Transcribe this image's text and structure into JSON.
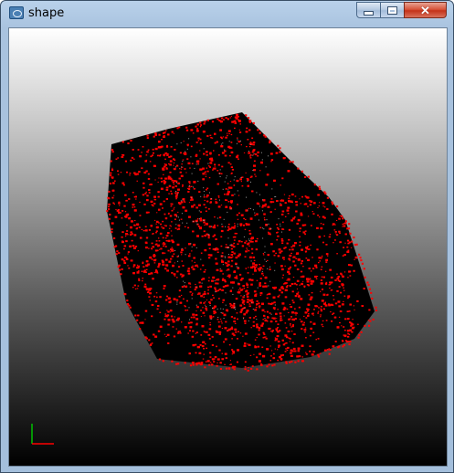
{
  "window": {
    "title": "shape",
    "icon": "app-window-icon",
    "controls": {
      "minimize_icon": "minimize-icon",
      "maximize_icon": "maximize-icon",
      "close_icon": "close-icon"
    }
  },
  "viewport": {
    "background_gradient": [
      "#ffffff",
      "#000000"
    ],
    "mesh_fill_color": "#000000",
    "point_color": "#ff0000",
    "axis_colors": {
      "x": "#ff0000",
      "y": "#00c000"
    }
  }
}
